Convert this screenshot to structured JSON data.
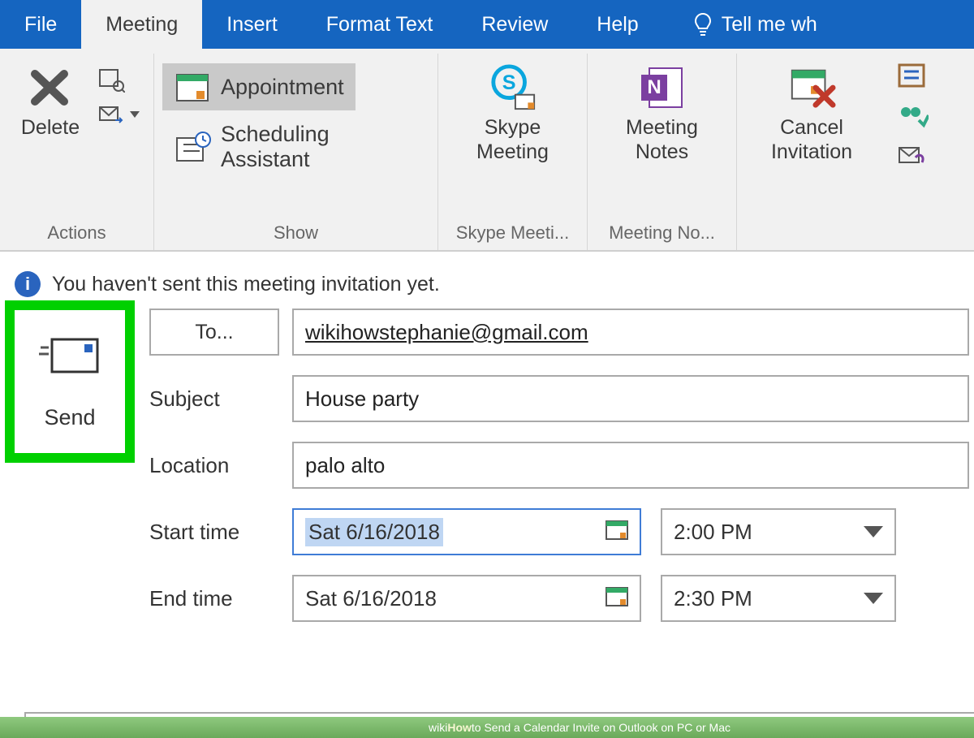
{
  "tabs": {
    "file": "File",
    "meeting": "Meeting",
    "insert": "Insert",
    "format_text": "Format Text",
    "review": "Review",
    "help": "Help",
    "tell_me": "Tell me wh"
  },
  "ribbon": {
    "actions": {
      "delete": "Delete",
      "group_label": "Actions"
    },
    "show": {
      "appointment": "Appointment",
      "scheduling": "Scheduling Assistant",
      "group_label": "Show"
    },
    "skype": {
      "line1": "Skype",
      "line2": "Meeting",
      "group_label": "Skype Meeti..."
    },
    "notes": {
      "line1": "Meeting",
      "line2": "Notes",
      "group_label": "Meeting No..."
    },
    "cancel": {
      "line1": "Cancel",
      "line2": "Invitation"
    }
  },
  "notice": "You haven't sent this meeting invitation yet.",
  "form": {
    "send": "Send",
    "to_button": "To...",
    "to_value": "wikihowstephanie@gmail.com",
    "subject_label": "Subject",
    "subject_value": "House party",
    "location_label": "Location",
    "location_value": "palo alto",
    "start_label": "Start time",
    "start_date": "Sat 6/16/2018",
    "start_time": "2:00 PM",
    "end_label": "End time",
    "end_date": "Sat 6/16/2018",
    "end_time": "2:30 PM"
  },
  "footer": {
    "prefix": "wiki",
    "how": "How",
    "rest": " to Send a Calendar Invite on Outlook on PC or Mac"
  }
}
